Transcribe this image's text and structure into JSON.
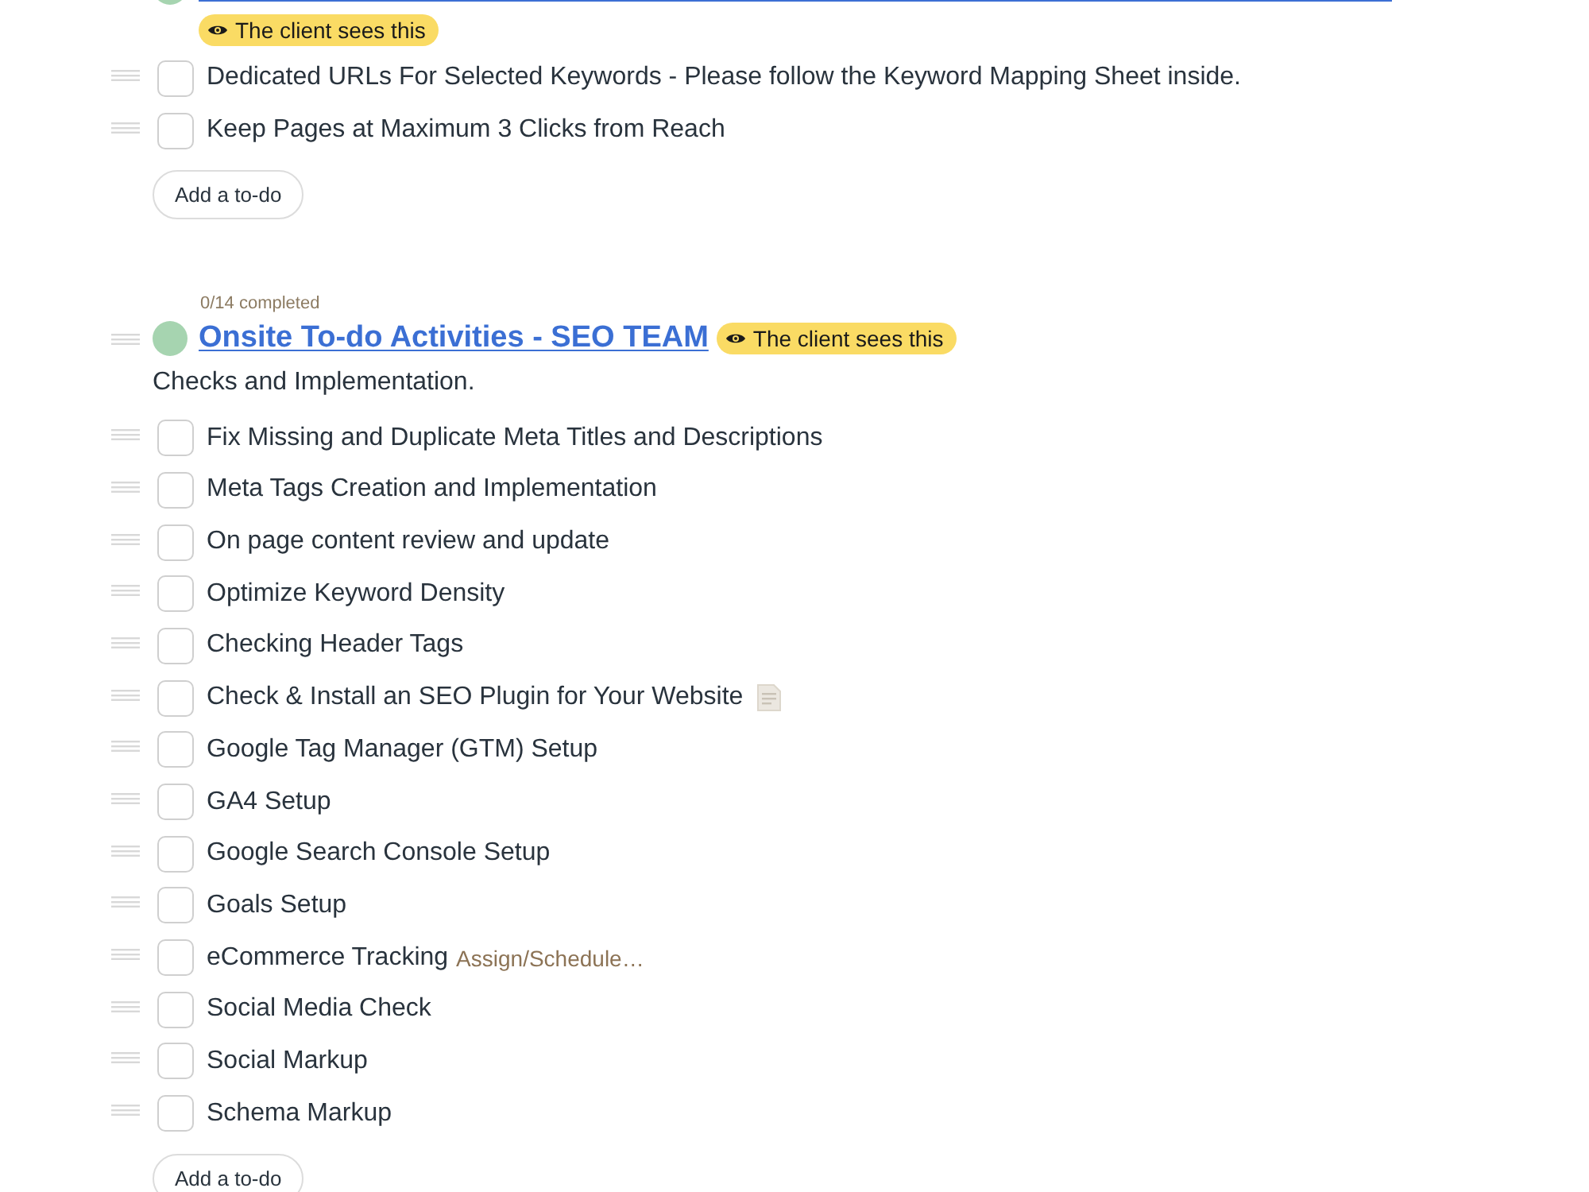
{
  "lists": [
    {
      "color": "#a6d4b0",
      "badge": "The client sees this",
      "todos": [
        {
          "text": "Dedicated URLs For Selected Keywords - Please follow the Keyword Mapping Sheet inside.",
          "checked": false,
          "has_notes": false
        },
        {
          "text": "Keep Pages at Maximum 3 Clicks from Reach",
          "checked": false,
          "has_notes": false
        }
      ],
      "add_button": "Add a to-do"
    },
    {
      "progress": "0/14 completed",
      "color": "#a6d4b0",
      "title": "Onsite To-do Activities - SEO TEAM",
      "badge": "The client sees this",
      "description": "Checks and Implementation.",
      "todos": [
        {
          "text": "Fix Missing and Duplicate Meta Titles and Descriptions",
          "checked": false,
          "has_notes": false
        },
        {
          "text": "Meta Tags Creation and Implementation",
          "checked": false,
          "has_notes": false
        },
        {
          "text": "On page content review and update",
          "checked": false,
          "has_notes": false
        },
        {
          "text": "Optimize Keyword Density",
          "checked": false,
          "has_notes": false
        },
        {
          "text": "Checking Header Tags",
          "checked": false,
          "has_notes": false
        },
        {
          "text": "Check & Install an SEO Plugin for Your Website",
          "checked": false,
          "has_notes": true
        },
        {
          "text": "Google Tag Manager (GTM) Setup",
          "checked": false,
          "has_notes": false
        },
        {
          "text": "GA4 Setup",
          "checked": false,
          "has_notes": false
        },
        {
          "text": "Google Search Console Setup",
          "checked": false,
          "has_notes": false
        },
        {
          "text": "Goals Setup",
          "checked": false,
          "has_notes": false
        },
        {
          "text": "eCommerce Tracking",
          "checked": false,
          "has_notes": false,
          "assign_link": "Assign/Schedule…"
        },
        {
          "text": "Social Media Check",
          "checked": false,
          "has_notes": false
        },
        {
          "text": "Social Markup",
          "checked": false,
          "has_notes": false
        },
        {
          "text": "Schema Markup",
          "checked": false,
          "has_notes": false
        }
      ],
      "add_button": "Add a to-do"
    }
  ]
}
